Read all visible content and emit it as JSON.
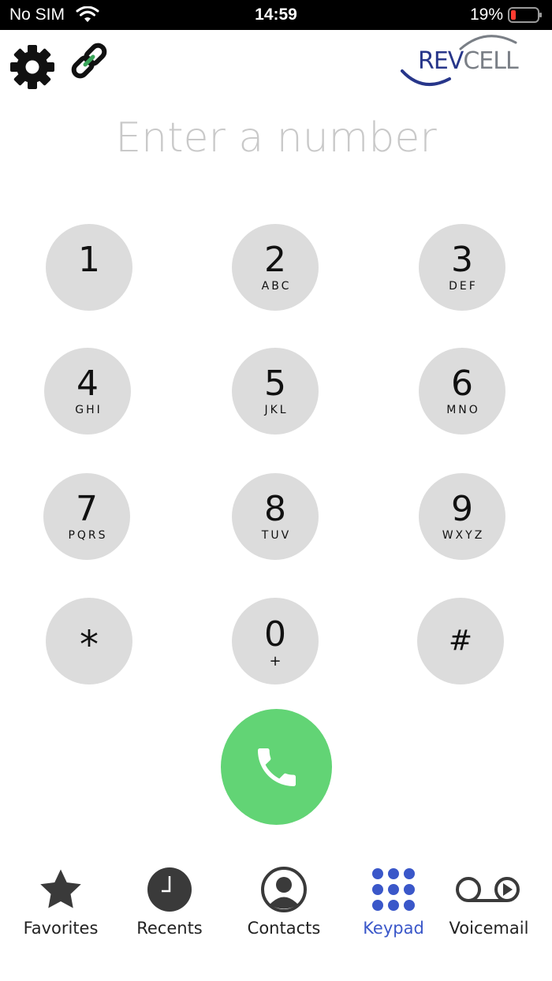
{
  "status_bar": {
    "carrier": "No SIM",
    "time": "14:59",
    "battery_percent": "19%"
  },
  "header": {
    "logo_text_part1": "REV",
    "logo_text_part2": "CELL"
  },
  "dialer": {
    "placeholder": "Enter a number"
  },
  "keypad": {
    "keys": [
      {
        "digit": "1",
        "letters": ""
      },
      {
        "digit": "2",
        "letters": "ABC"
      },
      {
        "digit": "3",
        "letters": "DEF"
      },
      {
        "digit": "4",
        "letters": "GHI"
      },
      {
        "digit": "5",
        "letters": "JKL"
      },
      {
        "digit": "6",
        "letters": "MNO"
      },
      {
        "digit": "7",
        "letters": "PQRS"
      },
      {
        "digit": "8",
        "letters": "TUV"
      },
      {
        "digit": "9",
        "letters": "WXYZ"
      },
      {
        "digit": "*",
        "letters": ""
      },
      {
        "digit": "0",
        "letters": "+"
      },
      {
        "digit": "#",
        "letters": ""
      }
    ]
  },
  "tab_bar": {
    "tabs": [
      {
        "label": "Favorites",
        "icon": "star-icon"
      },
      {
        "label": "Recents",
        "icon": "clock-icon"
      },
      {
        "label": "Contacts",
        "icon": "person-circle-icon"
      },
      {
        "label": "Keypad",
        "icon": "keypad-grid-icon"
      },
      {
        "label": "Voicemail",
        "icon": "voicemail-icon"
      }
    ],
    "active_tab": "Keypad"
  },
  "colors": {
    "key_background": "#dcdcdc",
    "call_button": "#62d475",
    "active_tab": "#3a57c9",
    "placeholder_text": "#c9c9c9",
    "logo_blue": "#27368a",
    "logo_gray": "#7a7f86",
    "link_green": "#3aa65a"
  }
}
